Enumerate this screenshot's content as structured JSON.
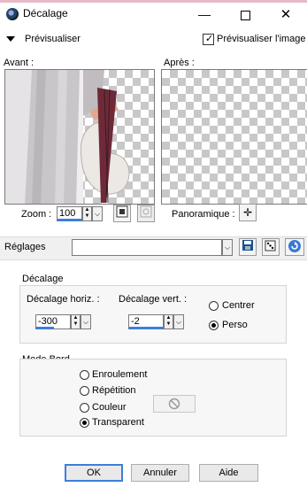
{
  "window": {
    "title": "Décalage",
    "min_glyph": "—",
    "close_glyph": "✕"
  },
  "preview": {
    "toggle_label": "Prévisualiser",
    "checkbox_label": "Prévisualiser l'image",
    "checkbox_checked": true,
    "before_label": "Avant :",
    "after_label": "Après :"
  },
  "zoom": {
    "label": "Zoom :",
    "value": "100"
  },
  "panoramique": {
    "label": "Panoramique :",
    "glyph": "✛"
  },
  "reglages": {
    "label": "Réglages",
    "value": ""
  },
  "decalage": {
    "group_label": "Décalage",
    "horiz_label": "Décalage horiz. :",
    "horiz_value": "-300",
    "vert_label": "Décalage vert. :",
    "vert_value": "-2",
    "options": [
      "Centrer",
      "Perso"
    ],
    "selected": "Perso"
  },
  "mode_bord": {
    "group_label": "Mode Bord",
    "options": [
      "Enroulement",
      "Répétition",
      "Couleur",
      "Transparent"
    ],
    "selected": "Transparent"
  },
  "buttons": {
    "ok": "OK",
    "cancel": "Annuler",
    "help": "Aide"
  },
  "colors": {
    "accent": "#3c7fd9",
    "title_strip": "#e8b9c7"
  }
}
